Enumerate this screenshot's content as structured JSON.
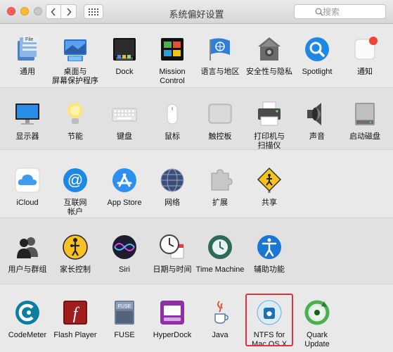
{
  "window": {
    "title": "系统偏好设置"
  },
  "search": {
    "placeholder": "搜索"
  },
  "rows": [
    [
      {
        "id": "general",
        "label": "通用",
        "icon": "general-icon"
      },
      {
        "id": "desktop",
        "label": "桌面与\n屏幕保护程序",
        "icon": "desktop-icon"
      },
      {
        "id": "dock",
        "label": "Dock",
        "icon": "dock-icon"
      },
      {
        "id": "mission-control",
        "label": "Mission\nControl",
        "icon": "mission-control-icon"
      },
      {
        "id": "language",
        "label": "语言与地区",
        "icon": "language-flag-icon"
      },
      {
        "id": "security",
        "label": "安全性与隐私",
        "icon": "security-house-icon"
      },
      {
        "id": "spotlight",
        "label": "Spotlight",
        "icon": "spotlight-icon"
      },
      {
        "id": "notifications",
        "label": "通知",
        "icon": "notifications-icon"
      }
    ],
    [
      {
        "id": "displays",
        "label": "显示器",
        "icon": "display-icon"
      },
      {
        "id": "energy",
        "label": "节能",
        "icon": "lightbulb-icon"
      },
      {
        "id": "keyboard",
        "label": "键盘",
        "icon": "keyboard-icon"
      },
      {
        "id": "mouse",
        "label": "鼠标",
        "icon": "mouse-icon"
      },
      {
        "id": "trackpad",
        "label": "触控板",
        "icon": "trackpad-icon"
      },
      {
        "id": "printers",
        "label": "打印机与\n扫描仪",
        "icon": "printer-icon"
      },
      {
        "id": "sound",
        "label": "声音",
        "icon": "speaker-icon"
      },
      {
        "id": "startup",
        "label": "启动磁盘",
        "icon": "hard-disk-icon"
      }
    ],
    [
      {
        "id": "icloud",
        "label": "iCloud",
        "icon": "icloud-icon"
      },
      {
        "id": "internet",
        "label": "互联网\n帐户",
        "icon": "at-sign-icon"
      },
      {
        "id": "appstore",
        "label": "App Store",
        "icon": "app-store-icon"
      },
      {
        "id": "network",
        "label": "网络",
        "icon": "network-globe-icon"
      },
      {
        "id": "extensions",
        "label": "扩展",
        "icon": "puzzle-icon"
      },
      {
        "id": "sharing",
        "label": "共享",
        "icon": "sharing-sign-icon"
      }
    ],
    [
      {
        "id": "users",
        "label": "用户与群组",
        "icon": "users-icon"
      },
      {
        "id": "parental",
        "label": "家长控制",
        "icon": "parental-controls-icon"
      },
      {
        "id": "siri",
        "label": "Siri",
        "icon": "siri-icon"
      },
      {
        "id": "datetime",
        "label": "日期与时间",
        "icon": "clock-calendar-icon"
      },
      {
        "id": "timemachine",
        "label": "Time Machine",
        "icon": "time-machine-icon"
      },
      {
        "id": "accessibility",
        "label": "辅助功能",
        "icon": "accessibility-icon"
      }
    ],
    [
      {
        "id": "codemeter",
        "label": "CodeMeter",
        "icon": "codemeter-icon"
      },
      {
        "id": "flash",
        "label": "Flash Player",
        "icon": "flash-icon"
      },
      {
        "id": "fuse",
        "label": "FUSE",
        "icon": "fuse-disk-icon"
      },
      {
        "id": "hyperdock",
        "label": "HyperDock",
        "icon": "hyperdock-icon"
      },
      {
        "id": "java",
        "label": "Java",
        "icon": "java-cup-icon"
      },
      {
        "id": "ntfs",
        "label": "NTFS for\nMac OS X",
        "icon": "ntfs-icon"
      },
      {
        "id": "quark",
        "label": "Quark\nUpdate",
        "icon": "quark-update-icon"
      }
    ]
  ]
}
